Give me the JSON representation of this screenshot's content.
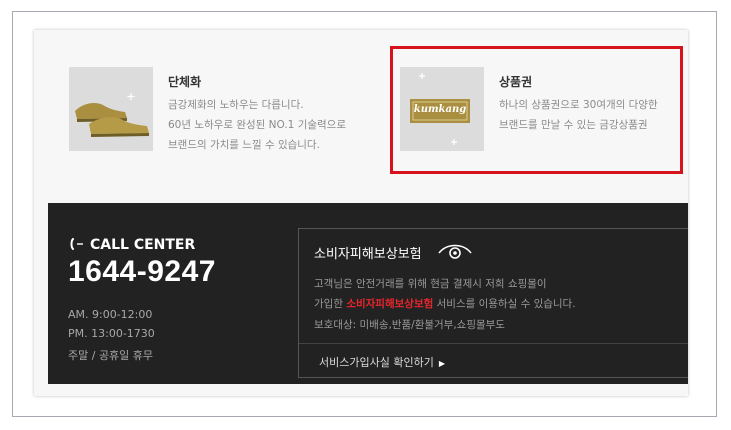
{
  "features": [
    {
      "title": "단체화",
      "desc_lines": [
        "금강제화의 노하우는 다릅니다.",
        "60년 노하우로 완성된 NO.1 기술력으로",
        "브랜드의 가치를 느낄 수 있습니다."
      ],
      "icon": "dress-shoes-icon"
    },
    {
      "title": "상품권",
      "desc_lines": [
        "하나의 상품권으로 30여개의 다양한",
        "브랜드를 만날 수 있는 금강상품권"
      ],
      "icon": "gift-card-icon",
      "card_brand": "kumkang"
    }
  ],
  "call_center": {
    "label": "CALL CENTER",
    "number": "1644-9247",
    "hours": [
      "AM. 9:00-12:00",
      "PM. 13:00-1730",
      "주말 / 공휴일 휴무"
    ]
  },
  "protection": {
    "title": "소비자피해보상보험",
    "line1": "고객님은 안전거래를 위해 현금 결제시 저희 쇼핑몰이",
    "line2_prefix": "가입한 ",
    "line2_highlight": "소비자피해보상보험",
    "line2_suffix": " 서비스를 이용하실 수 있습니다.",
    "line3": "보호대상: 미배송,반품/환불거부,쇼핑몰부도",
    "link": "서비스가입사실 확인하기"
  },
  "colors": {
    "highlight_red": "#d6121c",
    "dark_bg": "#222222",
    "accent_red_text": "#e4262d",
    "gold": "#a98f3f"
  }
}
